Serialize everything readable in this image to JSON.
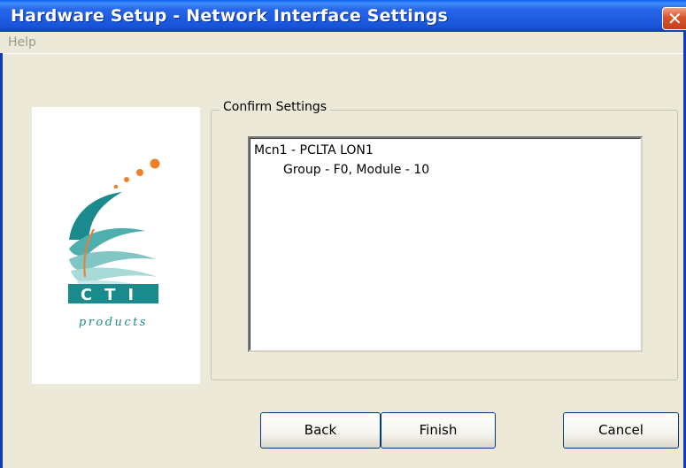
{
  "window": {
    "title": "Hardware Setup - Network Interface Settings"
  },
  "menu": {
    "help": "Help"
  },
  "logo": {
    "brand": "CTI",
    "tagline": "products"
  },
  "group": {
    "label": "Confirm Settings"
  },
  "settings_list": {
    "items": [
      "Mcn1 - PCLTA LON1",
      "Group - F0, Module - 10"
    ]
  },
  "buttons": {
    "back": "Back",
    "finish": "Finish",
    "cancel": "Cancel"
  },
  "colors": {
    "titlebar": "#1D5CE0",
    "dialog": "#ECE9D8",
    "logo_orange": "#F07F2A",
    "logo_teal": "#1A8A8C"
  }
}
